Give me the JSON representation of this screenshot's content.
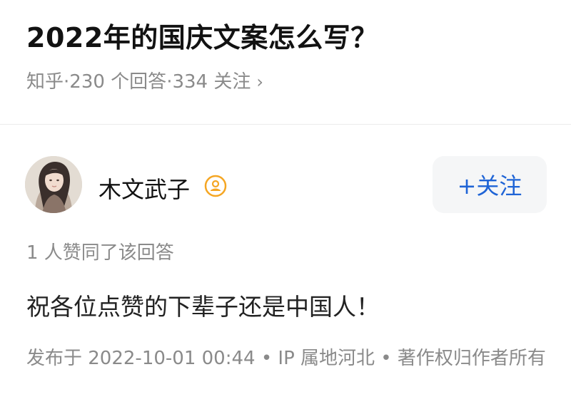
{
  "question": {
    "title": "2022年的国庆文案怎么写？",
    "source": "知乎",
    "answers": "230 个回答",
    "followers": "334 关注",
    "chevron": "›",
    "separator": "·"
  },
  "author": {
    "name": "木文武子",
    "badge_icon": "user-badge-icon",
    "follow_label": "+关注"
  },
  "likes_line": "1 人赞同了该回答",
  "answer": {
    "text": "祝各位点赞的下辈子还是中国人！",
    "meta": "发布于 2022-10-01 00:44 • IP 属地河北 • 著作权归作者所有"
  },
  "colors": {
    "accent": "#1f64d6",
    "badge": "#f5a623",
    "muted": "#8a8a8a"
  }
}
